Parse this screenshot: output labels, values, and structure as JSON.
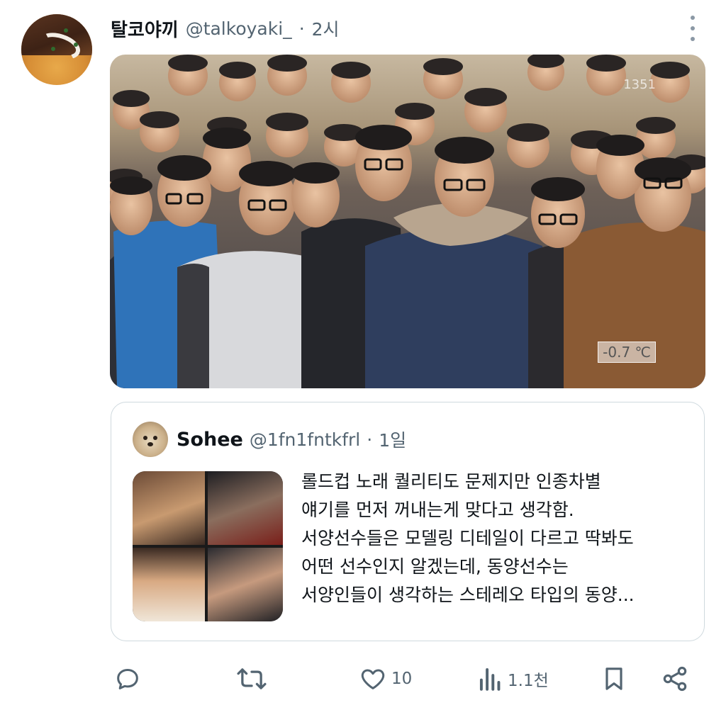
{
  "post": {
    "author_name": "탈코야끼",
    "author_handle": "@talkoyaki_",
    "separator": "·",
    "time": "2시",
    "media": {
      "watermark": "1351",
      "temperature_badge": "-0.7 ℃"
    }
  },
  "quote": {
    "author_name": "Sohee",
    "author_handle": "@1fn1fntkfrl",
    "separator": "·",
    "time": "1일",
    "text_lines": [
      "롤드컵 노래 퀄리티도 문제지만 인종차별",
      "얘기를 먼저 꺼내는게 맞다고 생각함.",
      "서양선수들은 모델링 디테일이 다르고 딱봐도",
      "어떤 선수인지 알겠는데, 동양선수는",
      "서양인들이 생각하는 스테레오 타입의 동양..."
    ]
  },
  "actions": {
    "reply_icon": "reply-icon",
    "retweet_icon": "retweet-icon",
    "like_icon": "heart-icon",
    "like_count": "10",
    "views_icon": "views-icon",
    "views_count": "1.1천",
    "bookmark_icon": "bookmark-icon",
    "share_icon": "share-icon"
  },
  "colors": {
    "text_primary": "#0f1419",
    "text_secondary": "#536471",
    "border": "#cfd9de"
  }
}
